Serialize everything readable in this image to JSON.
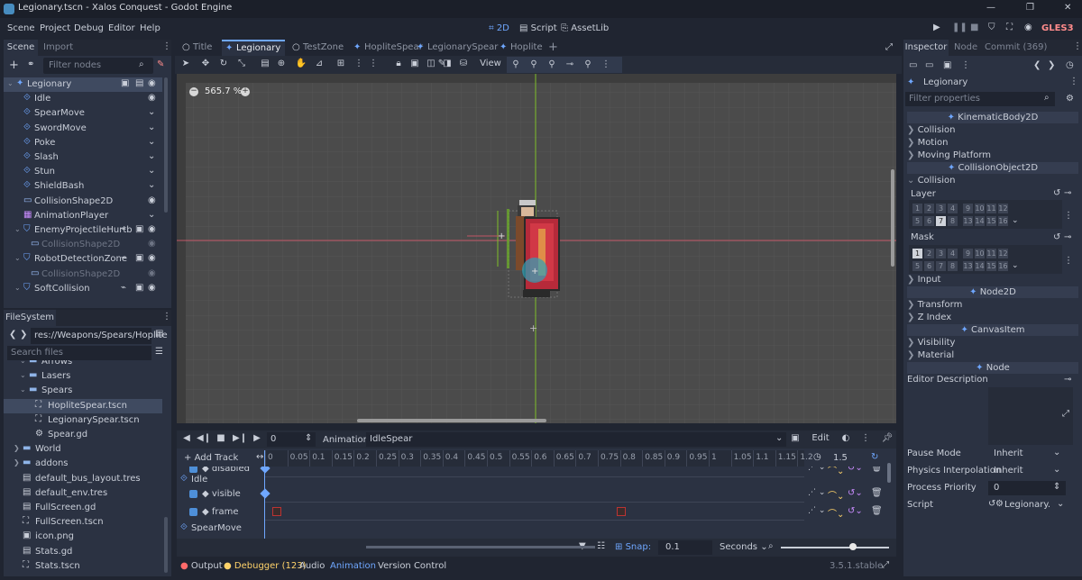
{
  "titlebar": {
    "title": "Legionary.tscn - Xalos Conquest - Godot Engine",
    "min": "—",
    "max": "❐",
    "close": "✕"
  },
  "menu": [
    "Scene",
    "Project",
    "Debug",
    "Editor",
    "Help"
  ],
  "workspaces": [
    "2D",
    "Script",
    "AssetLib"
  ],
  "renderer": "GLES3",
  "scene_panel": {
    "tab_scene": "Scene",
    "tab_import": "Import",
    "filter": "Filter nodes",
    "nodes": [
      {
        "label": "Legionary",
        "indent": 0
      },
      {
        "label": "Idle",
        "indent": 1
      },
      {
        "label": "SpearMove",
        "indent": 1
      },
      {
        "label": "SwordMove",
        "indent": 1
      },
      {
        "label": "Poke",
        "indent": 1
      },
      {
        "label": "Slash",
        "indent": 1
      },
      {
        "label": "Stun",
        "indent": 1
      },
      {
        "label": "ShieldBash",
        "indent": 1
      },
      {
        "label": "CollisionShape2D",
        "indent": 1
      },
      {
        "label": "AnimationPlayer",
        "indent": 1
      },
      {
        "label": "EnemyProjectileHurtb",
        "indent": 1
      },
      {
        "label": "CollisionShape2D",
        "indent": 2
      },
      {
        "label": "RobotDetectionZone",
        "indent": 1
      },
      {
        "label": "CollisionShape2D",
        "indent": 2
      },
      {
        "label": "SoftCollision",
        "indent": 1
      }
    ]
  },
  "filesystem": {
    "title": "FileSystem",
    "path": "res://Weapons/Spears/Hoplite",
    "search": "Search files",
    "items": [
      {
        "label": "Arrows",
        "indent": 2
      },
      {
        "label": "Lasers",
        "indent": 2
      },
      {
        "label": "Spears",
        "indent": 2
      },
      {
        "label": "HopliteSpear.tscn",
        "indent": 3
      },
      {
        "label": "LegionarySpear.tscn",
        "indent": 3
      },
      {
        "label": "Spear.gd",
        "indent": 3
      },
      {
        "label": "World",
        "indent": 1
      },
      {
        "label": "addons",
        "indent": 1
      },
      {
        "label": "default_bus_layout.tres",
        "indent": 1
      },
      {
        "label": "default_env.tres",
        "indent": 1
      },
      {
        "label": "FullScreen.gd",
        "indent": 1
      },
      {
        "label": "FullScreen.tscn",
        "indent": 1
      },
      {
        "label": "icon.png",
        "indent": 1
      },
      {
        "label": "Stats.gd",
        "indent": 1
      },
      {
        "label": "Stats.tscn",
        "indent": 1
      }
    ]
  },
  "tabs": [
    "Title",
    "Legionary",
    "TestZone",
    "HopliteSpear",
    "LegionarySpear",
    "Hoplite"
  ],
  "viewport": {
    "zoom": "565.7 %",
    "view": "View"
  },
  "animation": {
    "time": "0",
    "label": "Animation",
    "current": "IdleSpear",
    "edit": "Edit",
    "add_track": "Add Track",
    "ticks": [
      "0",
      "0.05",
      "0.1",
      "0.15",
      "0.2",
      "0.25",
      "0.3",
      "0.35",
      "0.4",
      "0.45",
      "0.5",
      "0.55",
      "0.6",
      "0.65",
      "0.7",
      "0.75",
      "0.8",
      "0.85",
      "0.9",
      "0.95",
      "1",
      "1.05",
      "1.1",
      "1.15",
      "1.2"
    ],
    "length": "1.5",
    "tracks": [
      {
        "label": "◆ disabled",
        "type": "prop"
      },
      {
        "label": "Idle",
        "type": "node"
      },
      {
        "label": "◆ visible",
        "type": "prop"
      },
      {
        "label": "◆ frame",
        "type": "prop"
      },
      {
        "label": "SpearMove",
        "type": "node"
      }
    ],
    "snap_label": "Snap:",
    "snap": "0.1",
    "unit": "Seconds"
  },
  "bottom": {
    "output": "Output",
    "debugger": "Debugger (123)",
    "audio": "Audio",
    "animation": "Animation",
    "vc": "Version Control",
    "version": "3.5.1.stable"
  },
  "inspector": {
    "tab_inspector": "Inspector",
    "tab_node": "Node",
    "tab_commit": "Commit (369)",
    "node": "Legionary",
    "filter": "Filter properties",
    "sections": [
      {
        "type": "class",
        "label": "KinematicBody2D"
      },
      {
        "type": "group",
        "label": "Collision"
      },
      {
        "type": "group",
        "label": "Motion"
      },
      {
        "type": "group",
        "label": "Moving Platform"
      },
      {
        "type": "class",
        "label": "CollisionObject2D"
      },
      {
        "type": "open",
        "label": "Collision"
      }
    ],
    "layer": "Layer",
    "mask": "Mask",
    "layer_row1": [
      "1",
      "2",
      "3",
      "4",
      "9",
      "10",
      "11",
      "12"
    ],
    "layer_row2": [
      "5",
      "6",
      "7",
      "8",
      "13",
      "14",
      "15",
      "16"
    ],
    "after": [
      {
        "type": "group",
        "label": "Input"
      },
      {
        "type": "class",
        "label": "Node2D"
      },
      {
        "type": "group",
        "label": "Transform"
      },
      {
        "type": "group",
        "label": "Z Index"
      },
      {
        "type": "class",
        "label": "CanvasItem"
      },
      {
        "type": "group",
        "label": "Visibility"
      },
      {
        "type": "group",
        "label": "Material"
      },
      {
        "type": "class",
        "label": "Node"
      }
    ],
    "editor_desc": "Editor Description",
    "props": [
      {
        "label": "Pause Mode",
        "value": "Inherit"
      },
      {
        "label": "Physics Interpolation",
        "value": "Inherit"
      },
      {
        "label": "Process Priority",
        "value": "0"
      },
      {
        "label": "Script",
        "value": "Legionary."
      }
    ]
  },
  "colors": {
    "bg": "#202531",
    "panel": "#2b3242",
    "accent": "#6fa7ff",
    "viewport": "#4a4a4a"
  }
}
